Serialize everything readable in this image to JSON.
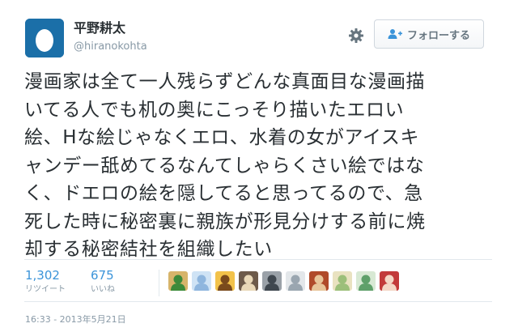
{
  "user": {
    "display_name": "平野耕太",
    "handle": "@hiranokohta"
  },
  "actions": {
    "follow_label": "フォローする"
  },
  "tweet": {
    "lines": [
      "漫画家は全て一人残らずどんな真面目な漫画描",
      "いてる人でも机の奥にこっそり描いたエロい",
      "絵、Hな絵じゃなくエロ、水着の女がアイスキ",
      "ャンデー舐めてるなんてしゃらくさい絵ではな",
      "く、ドエロの絵を隠してると思ってるので、急",
      "死した時に秘密裏に親族が形見分けする前に焼",
      "却する秘密結社を組織したい"
    ],
    "timestamp": "16:33 - 2013年5月21日"
  },
  "stats": {
    "retweets_count": "1,302",
    "retweets_label": "リツイート",
    "likes_count": "675",
    "likes_label": "いいね"
  },
  "likers": [
    {
      "bg": "#d7b46a",
      "fg": "#3c8a3a"
    },
    {
      "bg": "#cfe3f5",
      "fg": "#8fb6de"
    },
    {
      "bg": "#f2c24a",
      "fg": "#7a4a1c"
    },
    {
      "bg": "#6d5a4a",
      "fg": "#e9d8b8"
    },
    {
      "bg": "#9aa1a8",
      "fg": "#3f474f"
    },
    {
      "bg": "#e3e7ea",
      "fg": "#9aa6b0"
    },
    {
      "bg": "#b04a2a",
      "fg": "#e8c59a"
    },
    {
      "bg": "#e9e2c0",
      "fg": "#9cbf7a"
    },
    {
      "bg": "#d8e9d4",
      "fg": "#5fa06a"
    },
    {
      "bg": "#c23a3a",
      "fg": "#f4d7c6"
    }
  ],
  "colors": {
    "link_blue": "#3b94d9",
    "muted_gray": "#8899a6",
    "avatar_bg": "#1b6fa8"
  }
}
